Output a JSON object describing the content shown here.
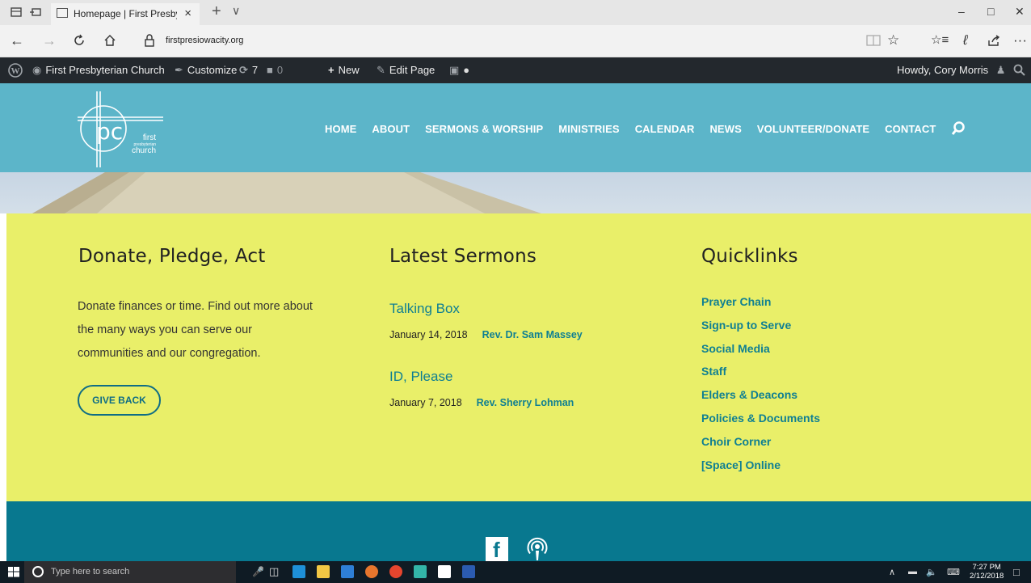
{
  "browser": {
    "tab_title": "Homepage | First Presby",
    "tab_close": "×",
    "new_tab": "+",
    "tab_list": "∨",
    "url": "firstpresiowacity.org",
    "more": "···"
  },
  "wp_admin_bar": {
    "site_name": "First Presbyterian Church",
    "customize": "Customize",
    "updates_count": "7",
    "comments_count": "0",
    "new": "New",
    "edit_page": "Edit Page",
    "howdy": "Howdy, Cory Morris"
  },
  "logo": {
    "letters": "pc",
    "line1": "first",
    "line2": "presbyterian",
    "line3": "church"
  },
  "nav": {
    "items": [
      "HOME",
      "ABOUT",
      "SERMONS & WORSHIP",
      "MINISTRIES",
      "CALENDAR",
      "NEWS",
      "VOLUNTEER/DONATE",
      "CONTACT"
    ]
  },
  "donate": {
    "heading": "Donate, Pledge, Act",
    "text": "Donate finances or time. Find out more about the many ways you can serve our communities and our congregation.",
    "button": "GIVE BACK"
  },
  "sermons": {
    "heading": "Latest Sermons",
    "items": [
      {
        "title": "Talking Box",
        "date": "January 14, 2018",
        "author": "Rev. Dr. Sam Massey"
      },
      {
        "title": "ID, Please",
        "date": "January 7, 2018",
        "author": "Rev. Sherry Lohman"
      }
    ]
  },
  "quicklinks": {
    "heading": "Quicklinks",
    "items": [
      "Prayer Chain",
      "Sign-up to Serve",
      "Social Media",
      "Staff",
      "Elders & Deacons",
      "Policies & Documents",
      "Choir Corner",
      "[Space] Online"
    ]
  },
  "footer": {
    "facebook_letter": "f"
  },
  "taskbar": {
    "search_placeholder": "Type here to search",
    "time": "7:27 PM",
    "date": "2/12/2018"
  },
  "colors": {
    "header": "#5cb5c9",
    "content": "#e9ef69",
    "footer": "#08788f",
    "link": "#0f7f92",
    "admin_bar": "#23282d"
  }
}
